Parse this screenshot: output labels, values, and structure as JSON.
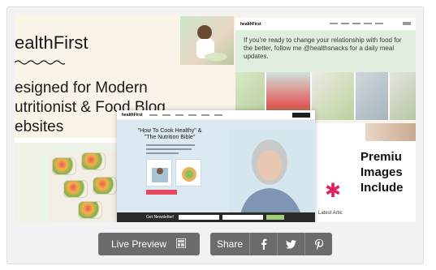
{
  "hero": {
    "brand": "ealthFirst",
    "lines": [
      "esigned for Modern",
      "utritionist & Food Blog",
      "ebsites"
    ]
  },
  "panel_b": {
    "logo": "healthFirst",
    "banner_text": "If you're ready to change your relationship with food for the better, follow me @healthsnacks for a daily meal updates."
  },
  "panel_d": {
    "logo": "healthFirst",
    "title": "\"How To Cook Healthy\" & \"The Nutrition Bible\"",
    "newsletter_label": "Get Newsletter!"
  },
  "panel_e": {
    "premium_lines": [
      "Premiu",
      "Images",
      "Include"
    ],
    "latest": "Latest Artic"
  },
  "buttons": {
    "live_preview": "Live Preview",
    "share": "Share"
  },
  "icons": {
    "live_preview": "image-gallery-icon",
    "facebook": "facebook-icon",
    "twitter": "twitter-icon",
    "pinterest": "pinterest-icon"
  },
  "colors": {
    "button_bg": "#6c6c6c",
    "accent_pink": "#e0245e",
    "banner_green": "#dfeedd"
  }
}
